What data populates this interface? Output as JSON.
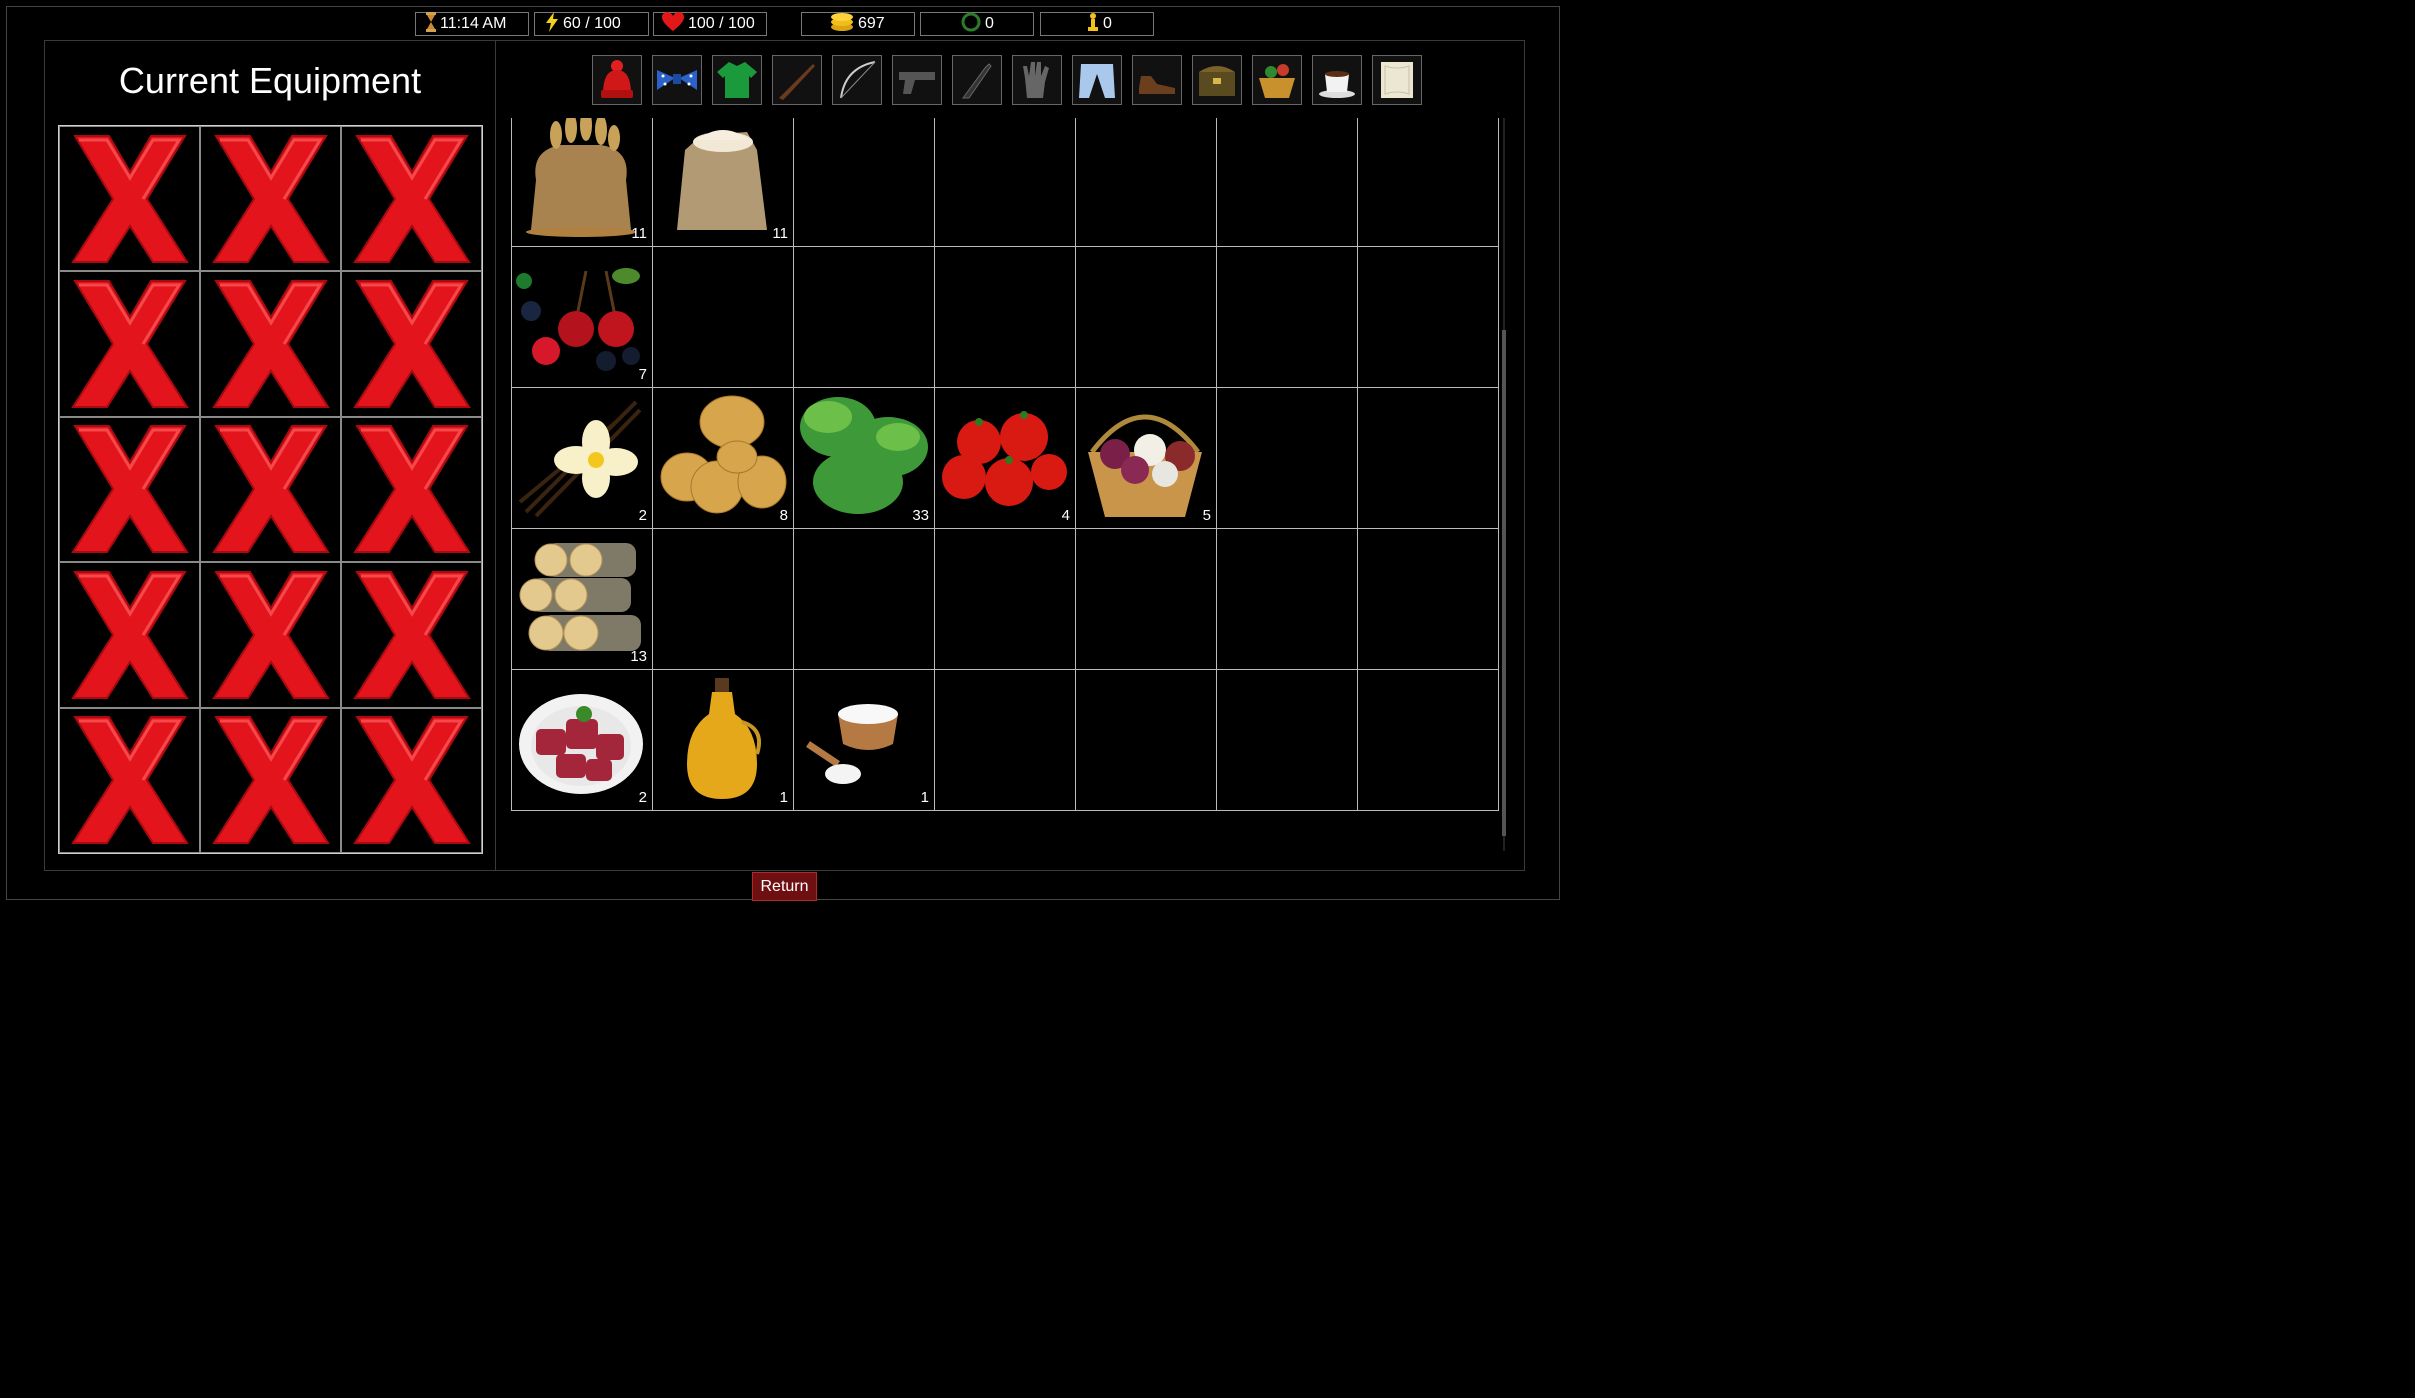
{
  "status": {
    "time": "11:14 AM",
    "energy": "60 / 100",
    "health": "100 / 100",
    "gold": "697",
    "laurel": "0",
    "trophy": "0"
  },
  "equipment": {
    "title": "Current Equipment",
    "slots": [
      "empty",
      "empty",
      "empty",
      "empty",
      "empty",
      "empty",
      "empty",
      "empty",
      "empty",
      "empty",
      "empty",
      "empty",
      "empty",
      "empty",
      "empty"
    ]
  },
  "tabs": [
    {
      "icon": "hat-icon"
    },
    {
      "icon": "bowtie-icon"
    },
    {
      "icon": "sweater-icon"
    },
    {
      "icon": "rifle-icon"
    },
    {
      "icon": "bow-icon"
    },
    {
      "icon": "pistol-icon"
    },
    {
      "icon": "knife-icon"
    },
    {
      "icon": "glove-icon"
    },
    {
      "icon": "trousers-icon"
    },
    {
      "icon": "shoes-icon"
    },
    {
      "icon": "chest-icon"
    },
    {
      "icon": "basket-icon"
    },
    {
      "icon": "coffee-icon"
    },
    {
      "icon": "paper-icon"
    }
  ],
  "inventory": [
    [
      {
        "item": "wheat-sack",
        "qty": "11"
      },
      {
        "item": "flour-sack",
        "qty": "11"
      },
      null,
      null,
      null,
      null,
      null
    ],
    [
      {
        "item": "berries",
        "qty": "7"
      },
      null,
      null,
      null,
      null,
      null,
      null
    ],
    [
      {
        "item": "vanilla",
        "qty": "2"
      },
      {
        "item": "potatoes",
        "qty": "8"
      },
      {
        "item": "lettuce",
        "qty": "33"
      },
      {
        "item": "tomatoes",
        "qty": "4"
      },
      {
        "item": "onions-basket",
        "qty": "5"
      },
      null,
      null
    ],
    [
      {
        "item": "firewood",
        "qty": "13"
      },
      null,
      null,
      null,
      null,
      null,
      null
    ],
    [
      {
        "item": "raw-meat",
        "qty": "2"
      },
      {
        "item": "oil-bottle",
        "qty": "1"
      },
      {
        "item": "salt",
        "qty": "1"
      },
      null,
      null,
      null,
      null
    ]
  ],
  "actions": {
    "return_label": "Return"
  },
  "colors": {
    "background": "#000000",
    "x_red": "#e3141c",
    "return_bg": "#6e0f12"
  }
}
